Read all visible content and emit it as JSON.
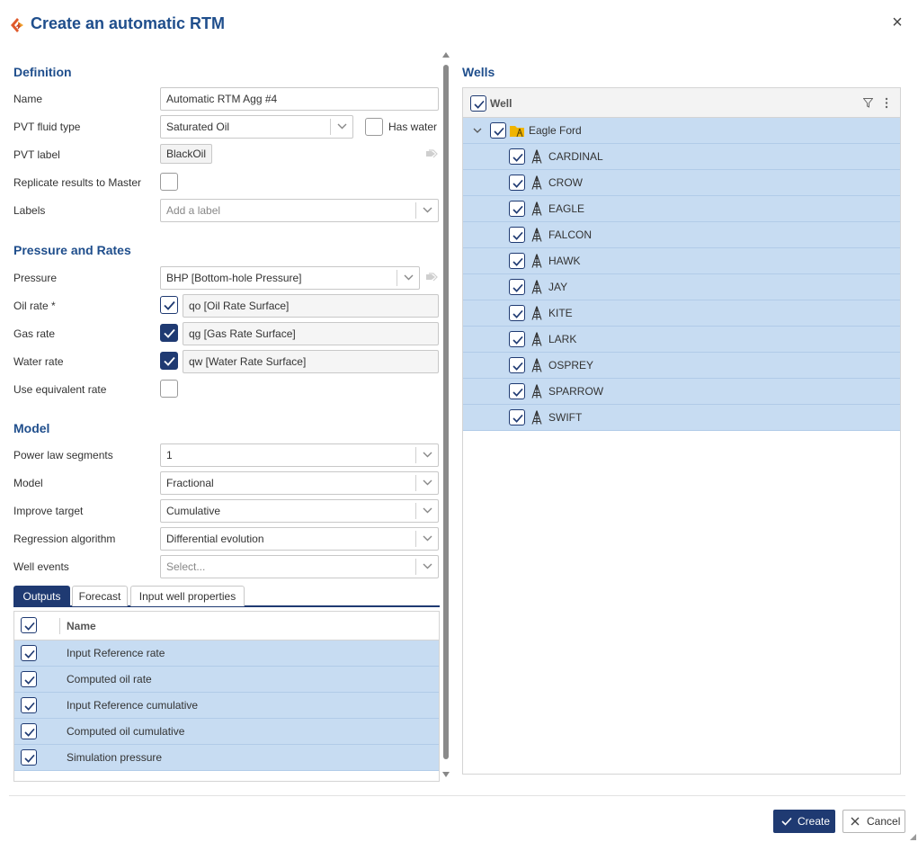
{
  "dialog": {
    "title": "Create an automatic RTM"
  },
  "definition": {
    "section_title": "Definition",
    "name_label": "Name",
    "name_value": "Automatic RTM Agg #4",
    "pvt_fluid_label": "PVT fluid type",
    "pvt_fluid_value": "Saturated Oil",
    "has_water_label": "Has water",
    "has_water_checked": false,
    "pvt_label_label": "PVT label",
    "pvt_label_value": "BlackOil",
    "replicate_label": "Replicate results to Master",
    "replicate_checked": false,
    "labels_label": "Labels",
    "labels_placeholder": "Add a label"
  },
  "pressure_rates": {
    "section_title": "Pressure and Rates",
    "pressure_label": "Pressure",
    "pressure_value": "BHP [Bottom-hole Pressure]",
    "oil_rate_label": "Oil rate *",
    "oil_rate_value": "qo [Oil Rate Surface]",
    "gas_rate_label": "Gas rate",
    "gas_rate_value": "qg [Gas Rate Surface]",
    "water_rate_label": "Water rate",
    "water_rate_value": "qw [Water Rate Surface]",
    "equiv_rate_label": "Use equivalent rate"
  },
  "model": {
    "section_title": "Model",
    "power_law_label": "Power law segments",
    "power_law_value": "1",
    "model_label": "Model",
    "model_value": "Fractional",
    "improve_label": "Improve target",
    "improve_value": "Cumulative",
    "regression_label": "Regression algorithm",
    "regression_value": "Differential evolution",
    "well_events_label": "Well events",
    "well_events_placeholder": "Select..."
  },
  "tabs": [
    "Outputs",
    "Forecast",
    "Input well properties"
  ],
  "outputs": {
    "column_name": "Name",
    "rows": [
      "Input Reference rate",
      "Computed oil rate",
      "Input Reference cumulative",
      "Computed oil cumulative",
      "Simulation pressure"
    ]
  },
  "wells": {
    "section_title": "Wells",
    "column_name": "Well",
    "group": "Eagle Ford",
    "items": [
      "CARDINAL",
      "CROW",
      "EAGLE",
      "FALCON",
      "HAWK",
      "JAY",
      "KITE",
      "LARK",
      "OSPREY",
      "SPARROW",
      "SWIFT"
    ]
  },
  "footer": {
    "create_label": "Create",
    "cancel_label": "Cancel"
  },
  "colors": {
    "accent": "#1f3a72",
    "title": "#1f4e8c",
    "selection": "#c7dcf2"
  }
}
